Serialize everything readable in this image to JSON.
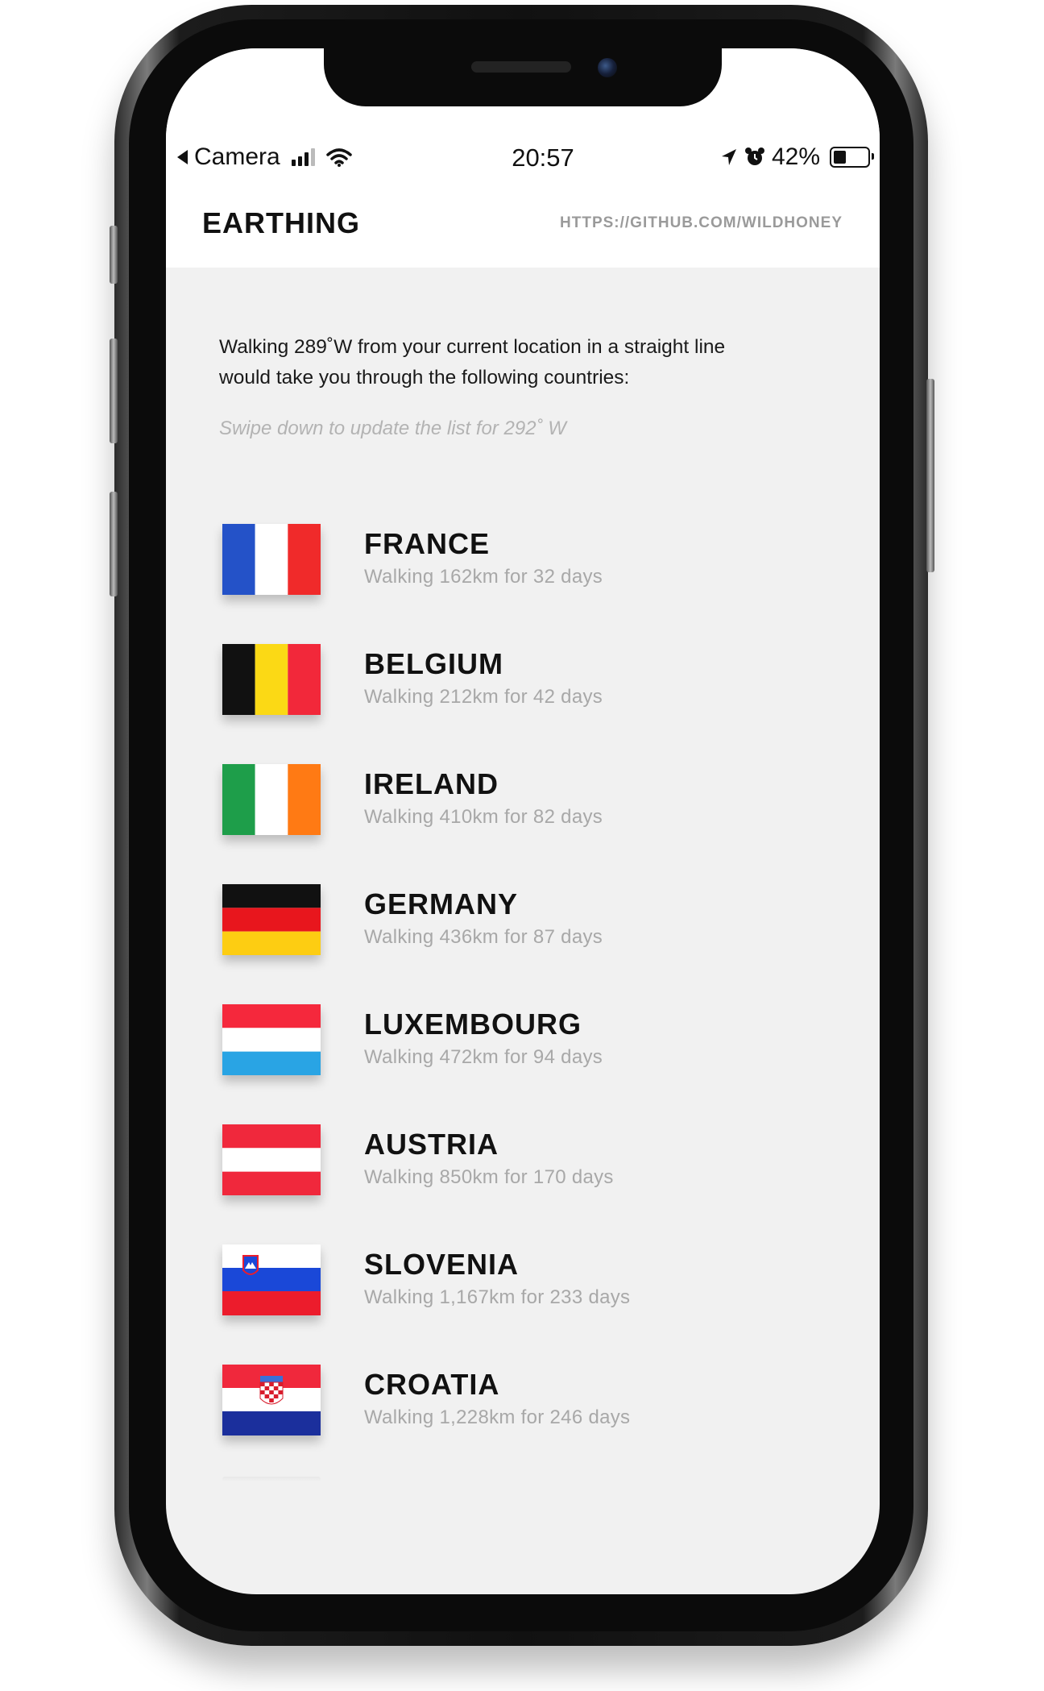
{
  "status_bar": {
    "back_app": "Camera",
    "time": "20:57",
    "battery": "42%",
    "battery_level": 0.42
  },
  "header": {
    "title": "EARTHING",
    "link": "HTTPS://GITHUB.COM/WILDHONEY"
  },
  "intro": {
    "line1": "Walking 289˚W from your current location in a straight line",
    "line2": "would take you through the following countries:",
    "hint": "Swipe down to update the list for 292˚ W"
  },
  "countries": [
    {
      "name": "FRANCE",
      "detail": "Walking 162km for 32 days",
      "flag": "france-flag"
    },
    {
      "name": "BELGIUM",
      "detail": "Walking 212km for 42 days",
      "flag": "belgium-flag"
    },
    {
      "name": "IRELAND",
      "detail": "Walking 410km for 82 days",
      "flag": "ireland-flag"
    },
    {
      "name": "GERMANY",
      "detail": "Walking 436km for 87 days",
      "flag": "germany-flag"
    },
    {
      "name": "LUXEMBOURG",
      "detail": "Walking 472km for 94 days",
      "flag": "luxembourg-flag"
    },
    {
      "name": "AUSTRIA",
      "detail": "Walking 850km for 170 days",
      "flag": "austria-flag"
    },
    {
      "name": "SLOVENIA",
      "detail": "Walking 1,167km for 233 days",
      "flag": "slovenia-flag"
    },
    {
      "name": "CROATIA",
      "detail": "Walking 1,228km for 246 days",
      "flag": "croatia-flag"
    }
  ],
  "colors": {
    "france": [
      "#2452c8",
      "#ffffff",
      "#f02a2a"
    ],
    "belgium": [
      "#111111",
      "#fbd915",
      "#f2283a"
    ],
    "ireland": [
      "#1e9e4a",
      "#ffffff",
      "#ff7a14"
    ],
    "germany": [
      "#111111",
      "#e8161d",
      "#fdcd12"
    ],
    "luxembourg": [
      "#f5283c",
      "#ffffff",
      "#29a4e4"
    ],
    "austria": [
      "#f0283c",
      "#ffffff",
      "#f0283c"
    ],
    "slovenia": [
      "#ffffff",
      "#1a48d8",
      "#ec1c2c"
    ],
    "croatia": [
      "#f0283c",
      "#ffffff",
      "#1b2f9c"
    ]
  }
}
